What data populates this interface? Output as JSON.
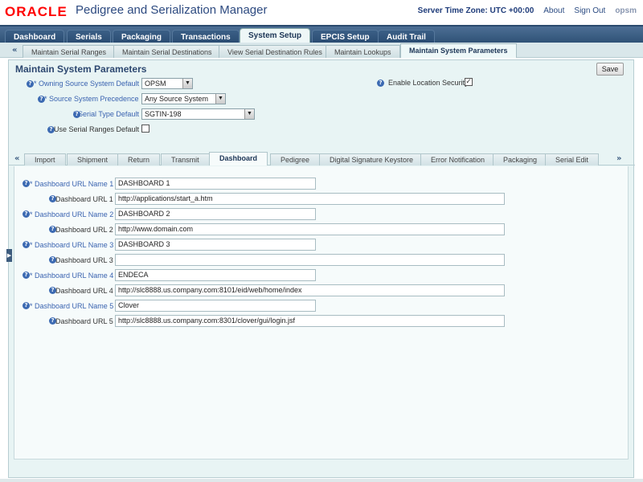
{
  "header": {
    "logo": "ORACLE",
    "title": "Pedigree and Serialization Manager",
    "server_time": "Server Time Zone: UTC +00:00",
    "about": "About",
    "sign_out": "Sign Out",
    "brand": "opsm"
  },
  "nav": {
    "tabs": [
      "Dashboard",
      "Serials",
      "Packaging",
      "Transactions",
      "System Setup",
      "EPCIS Setup",
      "Audit Trail"
    ],
    "active": "System Setup"
  },
  "subnav": {
    "tabs": [
      "Maintain Serial Ranges",
      "Maintain Serial Destinations",
      "View Serial Destination Rules",
      "Maintain Lookups",
      "Maintain System Parameters"
    ],
    "active": "Maintain System Parameters",
    "left_arrow": "«"
  },
  "panel": {
    "title": "Maintain System Parameters",
    "save_label": "Save",
    "owning_label": "* Owning Source System Default",
    "owning_value": "OPSM",
    "precedence_label": "* Source System Precedence",
    "precedence_value": "Any Source System",
    "serial_type_label": "* Serial Type Default",
    "serial_type_value": "SGTIN-198",
    "ranges_label": "Use Serial Ranges Default",
    "location_label": "Enable Location Security",
    "location_checked": true,
    "ranges_checked": false
  },
  "inner_tabs": {
    "tabs": [
      "Import",
      "Shipment",
      "Return",
      "Transmit",
      "Dashboard",
      "Pedigree",
      "Digital Signature Keystore",
      "Error Notification",
      "Packaging",
      "Serial Edit"
    ],
    "active": "Dashboard",
    "left_arrow": "«",
    "right_arrow": "»"
  },
  "dashboard": {
    "rows": [
      {
        "name_label": "* Dashboard URL Name 1",
        "name_value": "DASHBOARD 1",
        "url_label": "Dashboard URL 1",
        "url_value": "http://applications/start_a.htm"
      },
      {
        "name_label": "* Dashboard URL Name 2",
        "name_value": "DASHBOARD 2",
        "url_label": "Dashboard URL 2",
        "url_value": "http://www.domain.com"
      },
      {
        "name_label": "* Dashboard URL Name 3",
        "name_value": "DASHBOARD 3",
        "url_label": "Dashboard URL 3",
        "url_value": ""
      },
      {
        "name_label": "* Dashboard URL Name 4",
        "name_value": "ENDECA",
        "url_label": "Dashboard URL 4",
        "url_value": "http://slc8888.us.company.com:8101/eid/web/home/index"
      },
      {
        "name_label": "* Dashboard URL Name 5",
        "name_value": "Clover",
        "url_label": "Dashboard URL 5",
        "url_value": "http://slc8888.us.company.com:8301/clover/gui/login.jsf"
      }
    ]
  },
  "colors": {
    "nav_bg": "#2f5276",
    "panel_bg": "#e8f4f4",
    "accent": "#2d4870",
    "oracle_red": "#ff0000"
  }
}
